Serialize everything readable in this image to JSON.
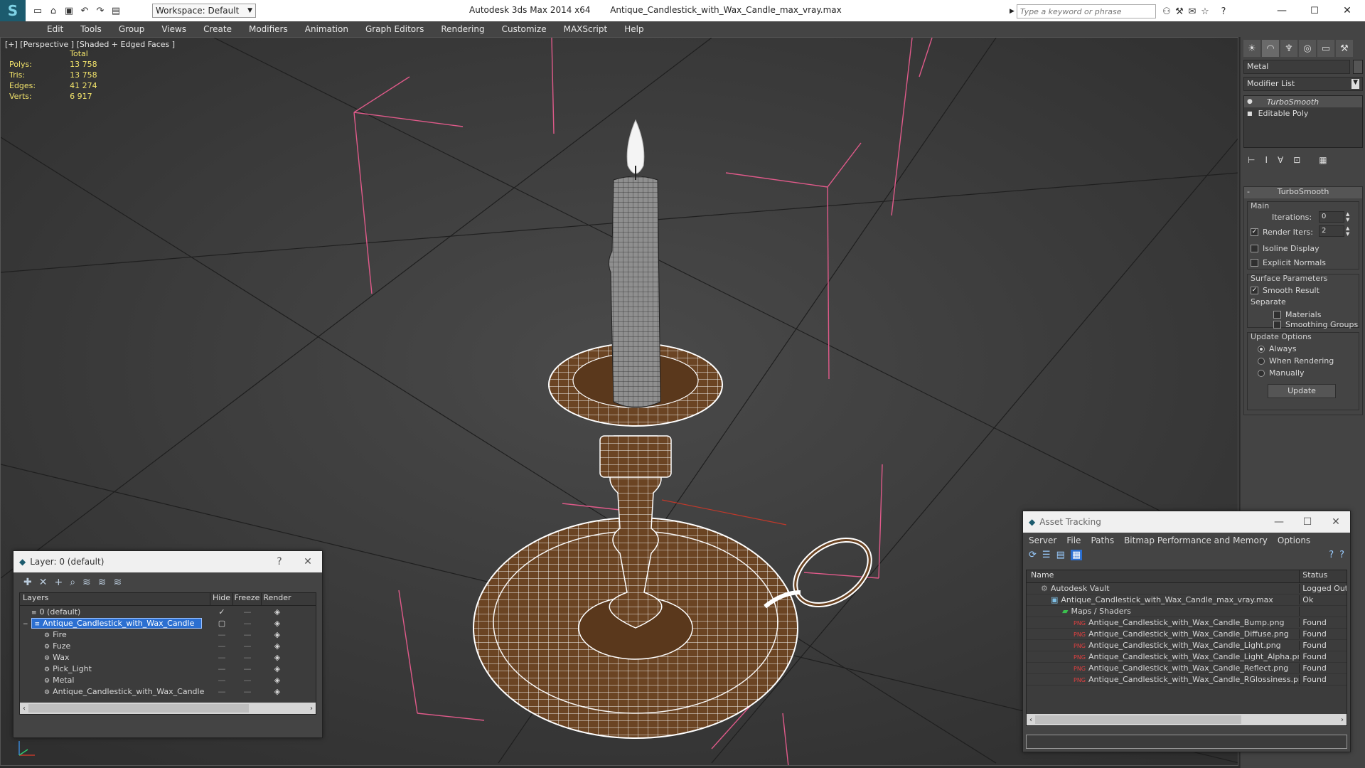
{
  "app": {
    "title": "Autodesk 3ds Max 2014 x64",
    "filename": "Antique_Candlestick_with_Wax_Candle_max_vray.max",
    "workspace": "Workspace: Default",
    "search_placeholder": "Type a keyword or phrase"
  },
  "menu": [
    "Edit",
    "Tools",
    "Group",
    "Views",
    "Create",
    "Modifiers",
    "Animation",
    "Graph Editors",
    "Rendering",
    "Customize",
    "MAXScript",
    "Help"
  ],
  "viewport": {
    "label": "[+] [Perspective ] [Shaded + Edged Faces ]",
    "stats": {
      "header": "Total",
      "rows": [
        {
          "label": "Polys:",
          "value": "13 758"
        },
        {
          "label": "Tris:",
          "value": "13 758"
        },
        {
          "label": "Edges:",
          "value": "41 274"
        },
        {
          "label": "Verts:",
          "value": "6 917"
        }
      ]
    }
  },
  "command_panel": {
    "object_name": "Metal",
    "modifier_list_label": "Modifier List",
    "stack": [
      "TurboSmooth",
      "Editable Poly"
    ],
    "rollout_title": "TurboSmooth",
    "main_label": "Main",
    "iterations_label": "Iterations:",
    "iterations_value": "0",
    "render_iters_label": "Render Iters:",
    "render_iters_value": "2",
    "render_iters_checked": true,
    "isoline_label": "Isoline Display",
    "explicit_normals_label": "Explicit Normals",
    "surface_params_label": "Surface Parameters",
    "smooth_result_label": "Smooth Result",
    "separate_label": "Separate",
    "materials_label": "Materials",
    "smoothing_groups_label": "Smoothing Groups",
    "update_options_label": "Update Options",
    "always_label": "Always",
    "when_rendering_label": "When Rendering",
    "manually_label": "Manually",
    "update_button": "Update"
  },
  "layer_dialog": {
    "title": "Layer: 0 (default)",
    "help": "?",
    "columns": [
      "Layers",
      "Hide",
      "Freeze",
      "Render"
    ],
    "rows": [
      {
        "name": "0 (default)",
        "indent": 0,
        "selected": false
      },
      {
        "name": "Antique_Candlestick_with_Wax_Candle",
        "indent": 0,
        "selected": true
      },
      {
        "name": "Fire",
        "indent": 1,
        "selected": false
      },
      {
        "name": "Fuze",
        "indent": 1,
        "selected": false
      },
      {
        "name": "Wax",
        "indent": 1,
        "selected": false
      },
      {
        "name": "Pick_Light",
        "indent": 1,
        "selected": false
      },
      {
        "name": "Metal",
        "indent": 1,
        "selected": false
      },
      {
        "name": "Antique_Candlestick_with_Wax_Candle",
        "indent": 1,
        "selected": false
      }
    ]
  },
  "asset_dialog": {
    "title": "Asset Tracking",
    "menu": [
      "Server",
      "File",
      "Paths",
      "Bitmap Performance and Memory",
      "Options"
    ],
    "columns": [
      "Name",
      "Status"
    ],
    "rows": [
      {
        "name": "Autodesk Vault",
        "status": "Logged Out",
        "indent": 0,
        "icon": "vault"
      },
      {
        "name": "Antique_Candlestick_with_Wax_Candle_max_vray.max",
        "status": "Ok",
        "indent": 1,
        "icon": "max"
      },
      {
        "name": "Maps / Shaders",
        "status": "",
        "indent": 2,
        "icon": "folder"
      },
      {
        "name": "Antique_Candlestick_with_Wax_Candle_Bump.png",
        "status": "Found",
        "indent": 3,
        "icon": "png"
      },
      {
        "name": "Antique_Candlestick_with_Wax_Candle_Diffuse.png",
        "status": "Found",
        "indent": 3,
        "icon": "png"
      },
      {
        "name": "Antique_Candlestick_with_Wax_Candle_Light.png",
        "status": "Found",
        "indent": 3,
        "icon": "png"
      },
      {
        "name": "Antique_Candlestick_with_Wax_Candle_Light_Alpha.png",
        "status": "Found",
        "indent": 3,
        "icon": "png"
      },
      {
        "name": "Antique_Candlestick_with_Wax_Candle_Reflect.png",
        "status": "Found",
        "indent": 3,
        "icon": "png"
      },
      {
        "name": "Antique_Candlestick_with_Wax_Candle_RGlossiness.png",
        "status": "Found",
        "indent": 3,
        "icon": "png"
      }
    ]
  },
  "colors": {
    "accent": "#2b6fd1",
    "stats": "#f2e36b",
    "gizmo": "#e05a8a",
    "wood": "#6b4423",
    "wire": "#ffffff"
  }
}
